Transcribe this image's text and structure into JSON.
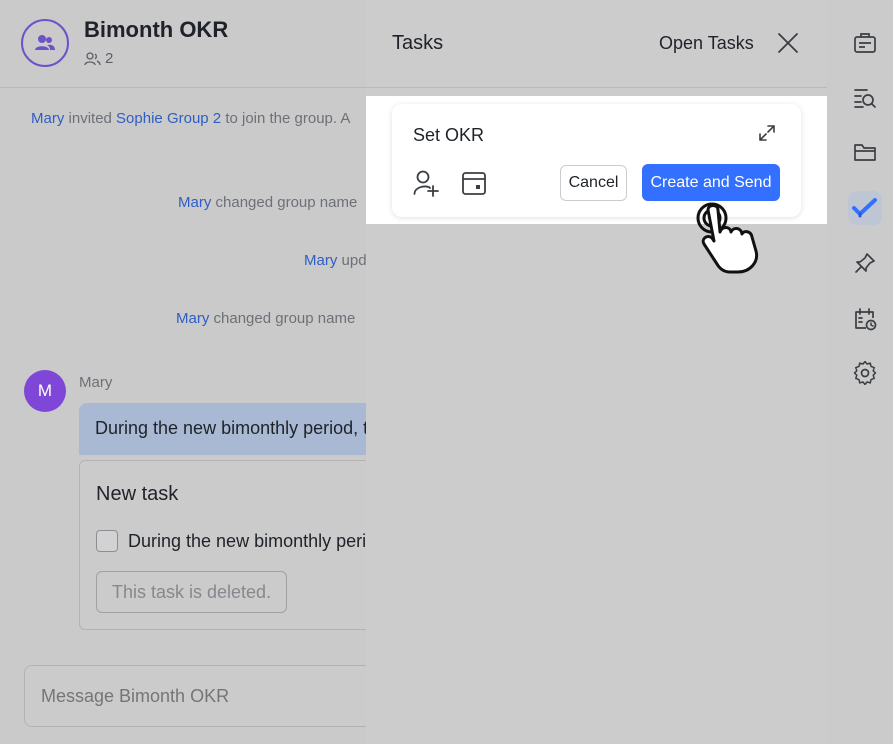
{
  "chat": {
    "title": "Bimonth OKR",
    "member_count": "2",
    "system_messages": [
      {
        "name": "Mary",
        "text": "invited",
        "name2": "Sophie",
        "name3": "Group 2",
        "tail": "to join the group. A"
      },
      {
        "name": "Mary",
        "text": "changed group name"
      },
      {
        "name": "Mary",
        "text": "upd"
      },
      {
        "name": "Mary",
        "text": "changed group name"
      }
    ],
    "message": {
      "avatar_letter": "M",
      "sender": "Mary",
      "text": "During the new bimonthly period, t",
      "task_card": {
        "title": "New task",
        "task_text": "During the new bimonthly perio",
        "deleted_label": "This task is deleted."
      }
    },
    "composer_placeholder": "Message Bimonth OKR"
  },
  "tasks_panel": {
    "title": "Tasks",
    "open_tasks_label": "Open Tasks",
    "new_task": {
      "value": "Set OKR",
      "cancel_label": "Cancel",
      "send_label": "Create and Send"
    }
  },
  "rail": {
    "items": [
      {
        "icon": "briefcase-icon",
        "active": false
      },
      {
        "icon": "search-list-icon",
        "active": false
      },
      {
        "icon": "folder-icon",
        "active": false
      },
      {
        "icon": "tasks-check-icon",
        "active": true
      },
      {
        "icon": "pin-icon",
        "active": false
      },
      {
        "icon": "calendar-clock-icon",
        "active": false
      },
      {
        "icon": "settings-gear-icon",
        "active": false
      }
    ]
  },
  "colors": {
    "accent": "#3370ff",
    "link_name": "#2f5ec4",
    "avatar_purple": "#7e47d8"
  }
}
